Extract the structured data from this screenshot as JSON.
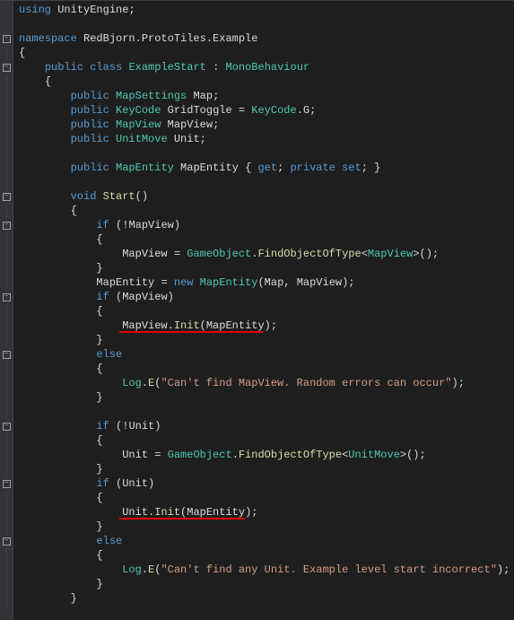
{
  "code": {
    "l1_using": "using",
    "l1_unity": "UnityEngine",
    "l3_namespace": "namespace",
    "l3_ns": "RedBjorn.ProtoTiles.Example",
    "l5_public": "public",
    "l5_class": "class",
    "l5_name": "ExampleStart",
    "l5_mb": "MonoBehaviour",
    "l7_public": "public",
    "l7_type": "MapSettings",
    "l7_name": "Map",
    "l8_public": "public",
    "l8_type": "KeyCode",
    "l8_name": "GridToggle",
    "l8_eq_type": "KeyCode",
    "l8_val": "G",
    "l9_public": "public",
    "l9_type": "MapView",
    "l9_name": "MapView",
    "l10_public": "public",
    "l10_type": "UnitMove",
    "l10_name": "Unit",
    "l12_public": "public",
    "l12_type": "MapEntity",
    "l12_name": "MapEntity",
    "l12_get": "get",
    "l12_private": "private",
    "l12_set": "set",
    "l14_void": "void",
    "l14_start": "Start",
    "l16_if": "if",
    "l16_var": "MapView",
    "l18_mapview": "MapView",
    "l18_go": "GameObject",
    "l18_find": "FindObjectOfType",
    "l18_t": "MapView",
    "l20_lhs": "MapEntity",
    "l20_new": "new",
    "l20_type": "MapEntity",
    "l20_arg1": "Map",
    "l20_arg2": "MapView",
    "l21_if": "if",
    "l21_var": "MapView",
    "l23_mv": "MapView",
    "l23_init": "Init",
    "l23_arg": "MapEntity",
    "l25_else": "else",
    "l27_log": "Log",
    "l27_e": "E",
    "l27_str": "\"Can't find MapView. Random errors can occur\"",
    "l30_if": "if",
    "l30_var": "Unit",
    "l32_unit": "Unit",
    "l32_go": "GameObject",
    "l32_find": "FindObjectOfType",
    "l32_t": "UnitMove",
    "l34_if": "if",
    "l34_var": "Unit",
    "l36_unit": "Unit",
    "l36_init": "Init",
    "l36_arg": "MapEntity",
    "l38_else": "else",
    "l40_log": "Log",
    "l40_e": "E",
    "l40_str": "\"Can't find any Unit. Example level start incorrect\""
  },
  "fold_glyph": "−"
}
